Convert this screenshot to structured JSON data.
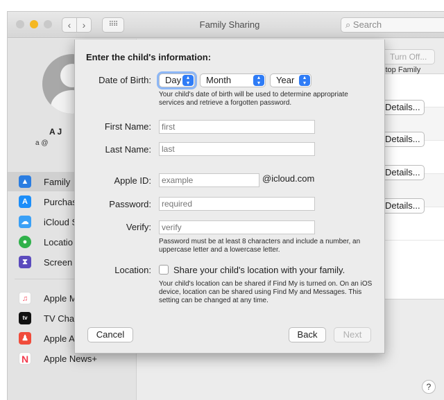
{
  "window": {
    "title": "Family Sharing",
    "search_placeholder": "Search",
    "nav_back": "‹",
    "nav_forward": "›",
    "grid_icon": "⠿⠿"
  },
  "sidebar": {
    "user_name": "A  J",
    "user_email": "a  @",
    "items": [
      {
        "label": "Family",
        "icon": "family-icon",
        "color": "#2a7de1",
        "selected": true
      },
      {
        "label": "Purchas",
        "icon": "app-store-icon",
        "color": "#1c8ef9"
      },
      {
        "label": "iCloud S",
        "icon": "cloud-icon",
        "color": "#3aa0f6"
      },
      {
        "label": "Locatio",
        "icon": "location-icon",
        "color": "#2fb14a"
      },
      {
        "label": "Screen",
        "icon": "hourglass-icon",
        "color": "#5b4bbd"
      },
      {
        "label": "Apple M",
        "icon": "music-icon",
        "color": "#f24a5d"
      },
      {
        "label": "TV Char",
        "icon": "apple-tv-icon",
        "color": "#111111"
      },
      {
        "label": "Apple A",
        "icon": "arcade-icon",
        "color": "#f04b3a"
      },
      {
        "label": "Apple News+",
        "icon": "news-icon",
        "color": "#f33a4d"
      }
    ]
  },
  "main": {
    "turn_off_label": "Turn Off...",
    "stop_family_text": "stop Family",
    "details_label": "Details...",
    "help": "?"
  },
  "sheet": {
    "heading": "Enter the child's information:",
    "dob_label": "Date of Birth:",
    "dob_day": "Day",
    "dob_month": "Month",
    "dob_year": "Year",
    "dob_note": "Your child's date of birth will be used to determine appropriate services and retrieve a forgotten password.",
    "first_name_label": "First Name:",
    "first_name_placeholder": "first",
    "last_name_label": "Last Name:",
    "last_name_placeholder": "last",
    "apple_id_label": "Apple ID:",
    "apple_id_placeholder": "example",
    "apple_id_suffix": "@icloud.com",
    "password_label": "Password:",
    "password_placeholder": "required",
    "verify_label": "Verify:",
    "verify_placeholder": "verify",
    "password_note": "Password must be at least 8 characters and include a number, an uppercase letter and a lowercase letter.",
    "location_label": "Location:",
    "location_checkbox_label": "Share your child's location with your family.",
    "location_checked": false,
    "location_note": "Your child's location can be shared if Find My is turned on. On an iOS device, location can be shared using Find My and Messages. This setting can be changed at any time.",
    "cancel_label": "Cancel",
    "back_label": "Back",
    "next_label": "Next"
  }
}
